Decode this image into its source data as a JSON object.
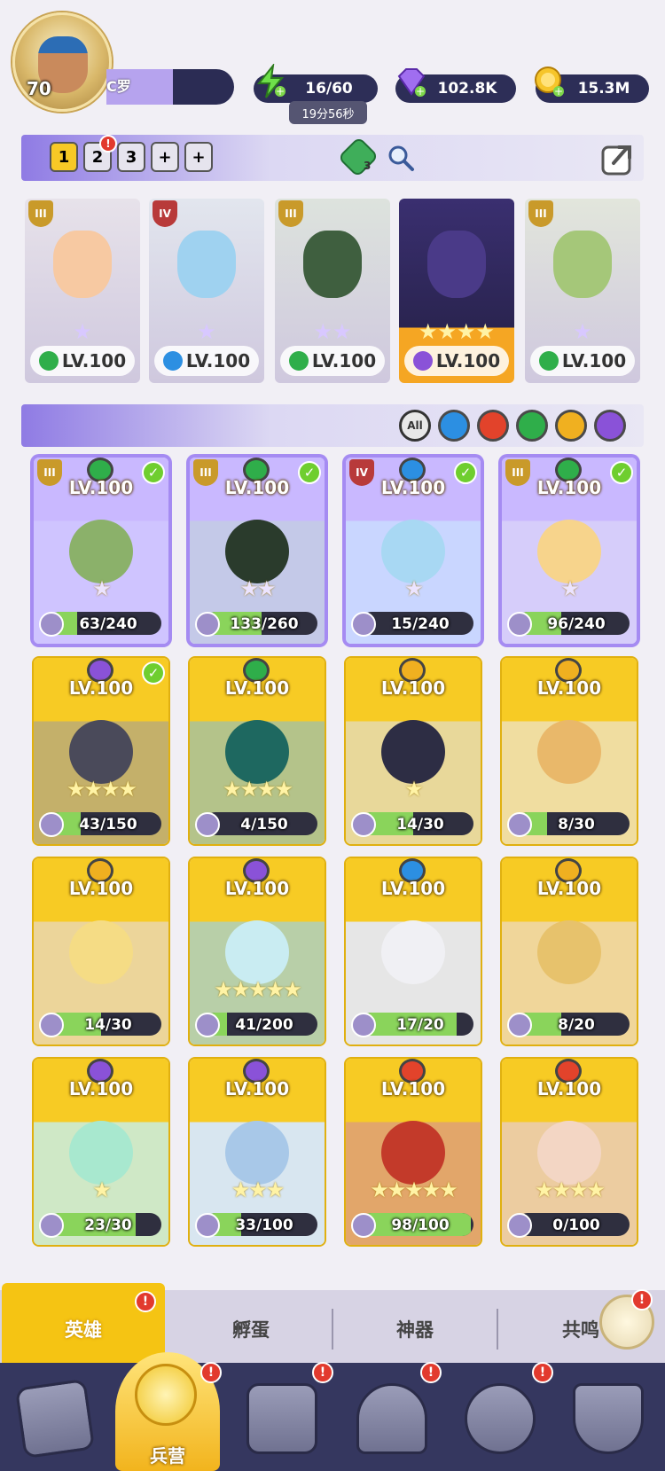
{
  "player": {
    "level": "70",
    "name": "C罗"
  },
  "resources": {
    "energy": "16/60",
    "energy_timer": "19分56秒",
    "gems": "102.8K",
    "gold": "15.3M"
  },
  "team_tabs": [
    "1",
    "2",
    "3",
    "+",
    "+"
  ],
  "team_tools": {
    "badge_count": "3"
  },
  "team_cards": [
    {
      "tier": "III",
      "level": "LV.100",
      "stars": "★",
      "element": "wind",
      "bg": "#e7e2ea",
      "face": "#f7c9a2"
    },
    {
      "tier": "IV",
      "level": "LV.100",
      "stars": "★",
      "element": "water",
      "bg": "#e2e6ee",
      "face": "#9fd2f0"
    },
    {
      "tier": "III",
      "level": "LV.100",
      "stars": "★★",
      "element": "wind",
      "bg": "#dde3dd",
      "face": "#3f5f3f"
    },
    {
      "tier": "",
      "level": "LV.100",
      "stars": "★★★★",
      "element": "dark",
      "bg": "#d8d6e6",
      "face": "#4a3a88"
    },
    {
      "tier": "III",
      "level": "LV.100",
      "stars": "★",
      "element": "wind",
      "bg": "#e2e6dc",
      "face": "#a5c779"
    }
  ],
  "filters": [
    "All",
    "water",
    "fire",
    "wind",
    "light",
    "dark"
  ],
  "heroes": [
    {
      "tier": "III",
      "level": "LV.100",
      "element": "wind",
      "checked": true,
      "stars": "★",
      "count": "63/240",
      "fill": 0.26,
      "bg": "#cfc4ff",
      "face": "#8bb16a",
      "frame": "purple"
    },
    {
      "tier": "III",
      "level": "LV.100",
      "element": "wind",
      "checked": true,
      "stars": "★★",
      "count": "133/260",
      "fill": 0.51,
      "bg": "#c4c9e8",
      "face": "#2a3b2c",
      "frame": "purple"
    },
    {
      "tier": "IV",
      "level": "LV.100",
      "element": "water",
      "checked": true,
      "stars": "★",
      "count": "15/240",
      "fill": 0.06,
      "bg": "#c9d6ff",
      "face": "#a8d8f3",
      "frame": "purple"
    },
    {
      "tier": "III",
      "level": "LV.100",
      "element": "wind",
      "checked": true,
      "stars": "★",
      "count": "96/240",
      "fill": 0.4,
      "bg": "#d6cdfa",
      "face": "#f7d48c",
      "frame": "purple"
    },
    {
      "tier": "",
      "level": "LV.100",
      "element": "dark",
      "checked": true,
      "stars": "★★★★",
      "count": "43/150",
      "fill": 0.29,
      "bg": "#c4b06a",
      "face": "#4a4a5a",
      "frame": "gold"
    },
    {
      "tier": "",
      "level": "LV.100",
      "element": "wind",
      "checked": false,
      "stars": "★★★★",
      "count": "4/150",
      "fill": 0.03,
      "bg": "#b4c38a",
      "face": "#1e6860",
      "frame": "gold"
    },
    {
      "tier": "",
      "level": "LV.100",
      "element": "light",
      "checked": false,
      "stars": "★",
      "count": "14/30",
      "fill": 0.47,
      "bg": "#e8d89a",
      "face": "#2d2d44",
      "frame": "gold"
    },
    {
      "tier": "",
      "level": "LV.100",
      "element": "light",
      "checked": false,
      "stars": "",
      "count": "8/30",
      "fill": 0.27,
      "bg": "#f0dda0",
      "face": "#e9b86a",
      "frame": "gold"
    },
    {
      "tier": "",
      "level": "LV.100",
      "element": "light",
      "checked": false,
      "stars": "",
      "count": "14/30",
      "fill": 0.47,
      "bg": "#ecd59a",
      "face": "#f5dc85",
      "frame": "gold"
    },
    {
      "tier": "",
      "level": "LV.100",
      "element": "dark",
      "checked": false,
      "stars": "★★★★★",
      "count": "41/200",
      "fill": 0.2,
      "bg": "#b8cfa8",
      "face": "#c9ecf2",
      "frame": "gold"
    },
    {
      "tier": "",
      "level": "LV.100",
      "element": "water",
      "checked": false,
      "stars": "",
      "count": "17/20",
      "fill": 0.85,
      "bg": "#e6e6e6",
      "face": "#f0f0f4",
      "frame": "gold"
    },
    {
      "tier": "",
      "level": "LV.100",
      "element": "light",
      "checked": false,
      "stars": "",
      "count": "8/20",
      "fill": 0.4,
      "bg": "#f0d69a",
      "face": "#e7c26c",
      "frame": "gold"
    },
    {
      "tier": "",
      "level": "LV.100",
      "element": "dark",
      "checked": false,
      "stars": "★",
      "count": "23/30",
      "fill": 0.77,
      "bg": "#cfe8c6",
      "face": "#a8e8cf",
      "frame": "gold"
    },
    {
      "tier": "",
      "level": "LV.100",
      "element": "dark",
      "checked": false,
      "stars": "★★★",
      "count": "33/100",
      "fill": 0.33,
      "bg": "#d8e6f0",
      "face": "#a8c8e8",
      "frame": "gold"
    },
    {
      "tier": "",
      "level": "LV.100",
      "element": "fire",
      "checked": false,
      "stars": "★★★★★",
      "count": "98/100",
      "fill": 0.98,
      "bg": "#e2a66a",
      "face": "#c33a2a",
      "frame": "gold"
    },
    {
      "tier": "",
      "level": "LV.100",
      "element": "fire",
      "checked": false,
      "stars": "★★★★",
      "count": "0/100",
      "fill": 0.0,
      "bg": "#eccca0",
      "face": "#f3d6c4",
      "frame": "gold"
    }
  ],
  "tabs": {
    "hero": "英雄",
    "hatch": "孵蛋",
    "artifact": "神器",
    "resonance": "共鸣"
  },
  "nav": {
    "barracks": "兵营",
    "badge": "!"
  },
  "colors": {
    "wind": "#2fae4a",
    "water": "#2c8fe2",
    "fire": "#e2432b",
    "light": "#f0b020",
    "dark": "#8a52d8",
    "accent": "#f5c413"
  }
}
